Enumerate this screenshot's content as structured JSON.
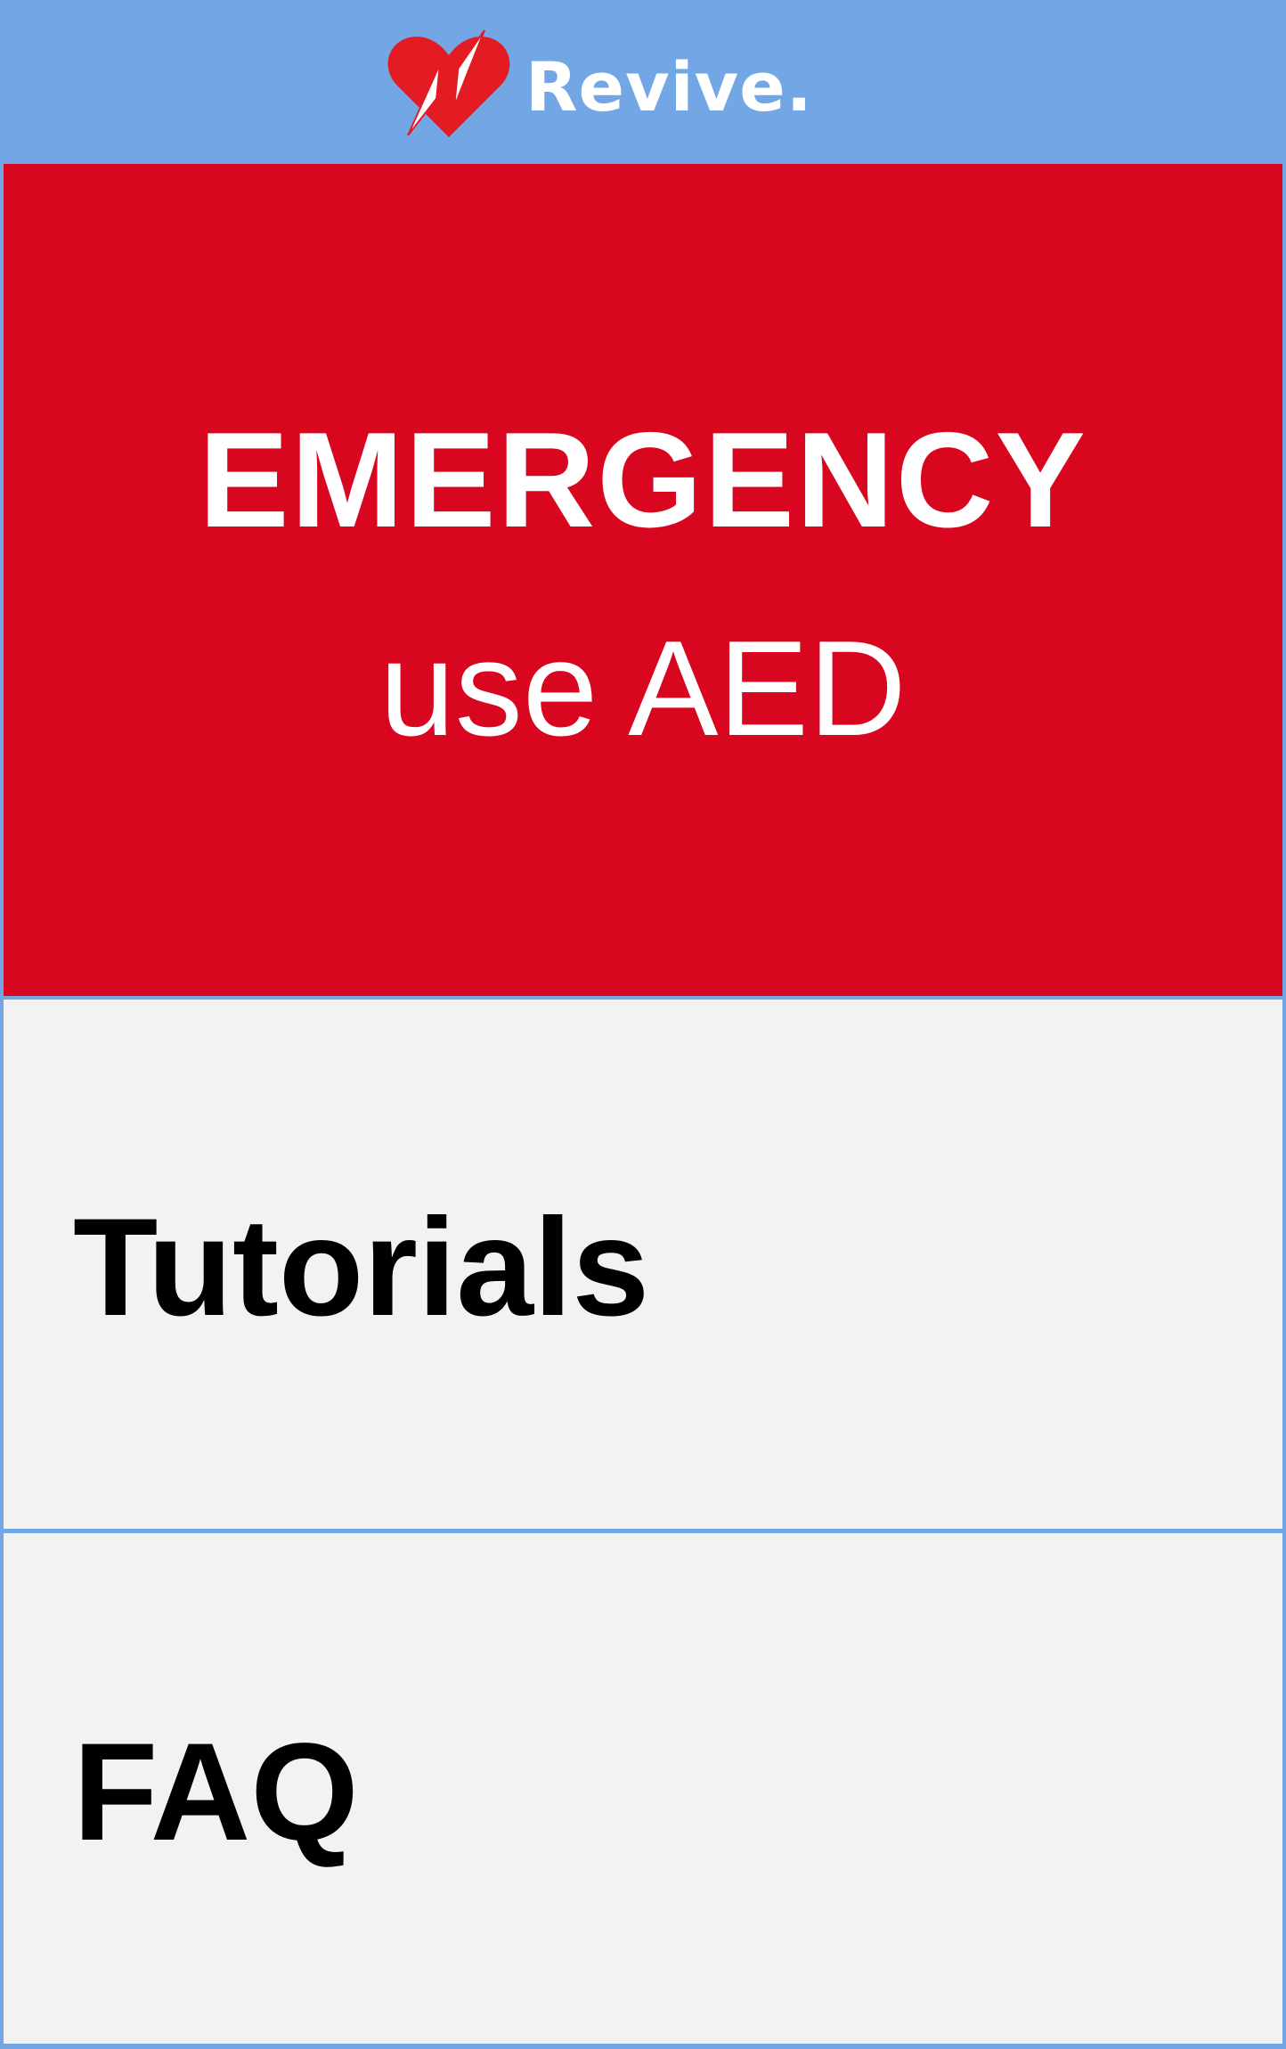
{
  "header": {
    "app_name": "Revive.",
    "logo_icon": "heart-lightning-icon",
    "logo_color": "#e31b23"
  },
  "emergency": {
    "title": "EMERGENCY",
    "subtitle": "use AED",
    "background": "#d9061f"
  },
  "menu": {
    "tutorials_label": "Tutorials",
    "faq_label": "FAQ"
  },
  "colors": {
    "header_background": "#72a6e4",
    "tile_background": "#f2f2f2"
  }
}
